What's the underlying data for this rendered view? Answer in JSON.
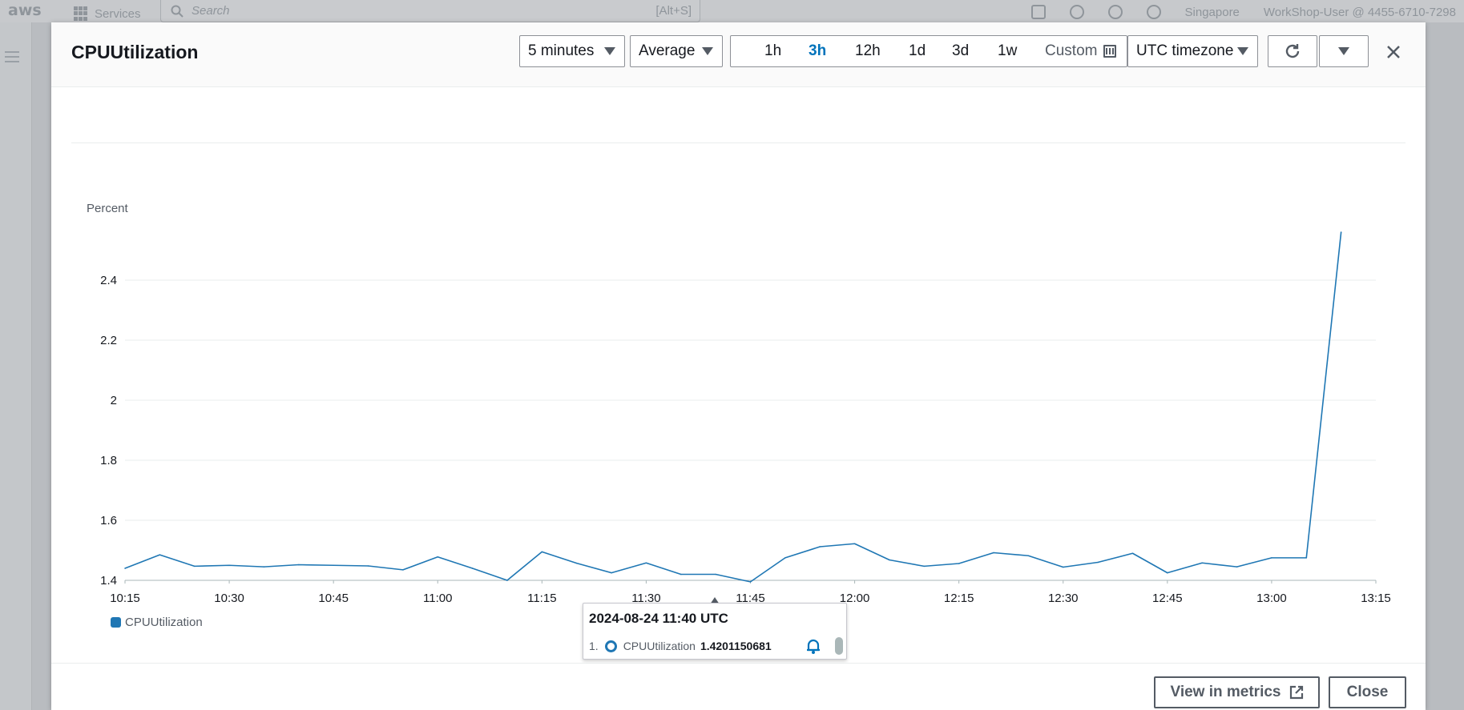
{
  "console": {
    "logo": "aws",
    "services_label": "Services",
    "search_placeholder": "Search",
    "search_shortcut": "[Alt+S]",
    "region": "Singapore",
    "account": "WorkShop-User @ 4455-6710-7298"
  },
  "modal": {
    "title": "CPUUtilization",
    "period_value": "5 minutes",
    "stat_value": "Average",
    "ranges": [
      "1h",
      "3h",
      "12h",
      "1d",
      "3d",
      "1w"
    ],
    "active_range": "3h",
    "custom_label": "Custom",
    "timezone": "UTC timezone",
    "buttons": {
      "view_in_metrics": "View in metrics",
      "close": "Close"
    }
  },
  "tooltip": {
    "time": "2024-08-24 11:40 UTC",
    "index": "1.",
    "metric": "CPUUtilization",
    "value": "1.4201150681"
  },
  "chart_data": {
    "type": "line",
    "ylabel": "Percent",
    "ylim": [
      1.4,
      2.6
    ],
    "yticks": [
      "1.4",
      "1.6",
      "1.8",
      "2",
      "2.2",
      "2.4"
    ],
    "xtick_labels": [
      "10:15",
      "10:30",
      "10:45",
      "11:00",
      "11:15",
      "11:30",
      "11:45",
      "12:00",
      "12:15",
      "12:30",
      "12:45",
      "13:00",
      "13:15"
    ],
    "x": [
      "10:15",
      "10:20",
      "10:25",
      "10:30",
      "10:35",
      "10:40",
      "10:45",
      "10:50",
      "10:55",
      "11:00",
      "11:05",
      "11:10",
      "11:15",
      "11:20",
      "11:25",
      "11:30",
      "11:35",
      "11:40",
      "11:45",
      "11:50",
      "11:55",
      "12:00",
      "12:05",
      "12:10",
      "12:15",
      "12:20",
      "12:25",
      "12:30",
      "12:35",
      "12:40",
      "12:45",
      "12:50",
      "12:55",
      "13:00",
      "13:05",
      "13:10"
    ],
    "series": [
      {
        "name": "CPUUtilization",
        "color": "#1f77b4",
        "values": [
          1.44,
          1.485,
          1.447,
          1.45,
          1.445,
          1.452,
          1.45,
          1.448,
          1.435,
          1.478,
          1.44,
          1.4,
          1.495,
          1.457,
          1.425,
          1.458,
          1.42,
          1.42,
          1.395,
          1.475,
          1.512,
          1.522,
          1.468,
          1.447,
          1.456,
          1.492,
          1.482,
          1.444,
          1.46,
          1.49,
          1.425,
          1.458,
          1.445,
          1.475,
          1.475,
          2.56
        ]
      }
    ],
    "grid": true,
    "legend": "bottom-left"
  }
}
